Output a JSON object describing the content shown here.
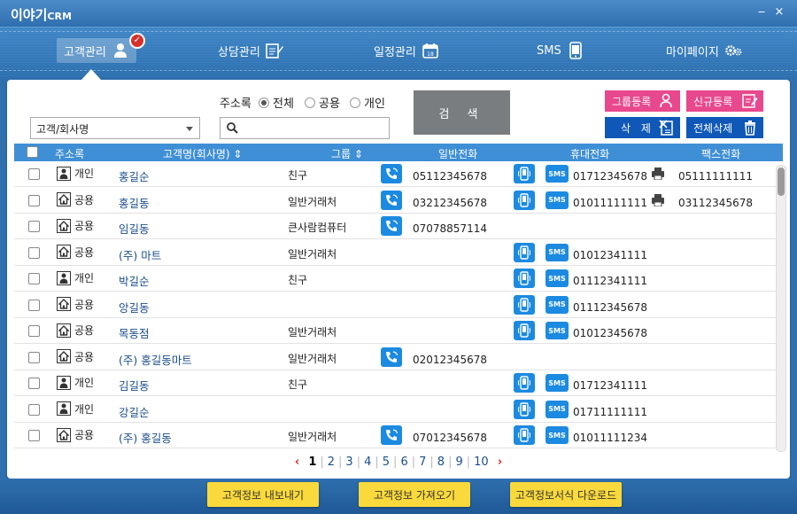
{
  "app": {
    "logo_main": "이야기",
    "logo_sub": "CRM",
    "min_label": "‒",
    "close_label": "×"
  },
  "nav": [
    {
      "label": "고객관리",
      "icon": "person-icon",
      "active": true
    },
    {
      "label": "상담관리",
      "icon": "notepad-edit-icon"
    },
    {
      "label": "일정관리",
      "icon": "calendar-icon"
    },
    {
      "label": "SMS",
      "icon": "phone-icon"
    },
    {
      "label": "마이페이지",
      "icon": "gears-icon"
    }
  ],
  "filter": {
    "select_value": "고객/회사명",
    "address_label": "주소록",
    "radios": [
      {
        "label": "전체",
        "checked": true
      },
      {
        "label": "공용",
        "checked": false
      },
      {
        "label": "개인",
        "checked": false
      }
    ],
    "search_placeholder": "",
    "search_button": "검 색"
  },
  "actions": {
    "group_register": "그룹등록",
    "new_register": "신규등록",
    "delete": "삭 제",
    "delete_all": "전체삭제"
  },
  "table": {
    "headers": {
      "address": "주소록",
      "name": "고객명(회사명)",
      "group": "그룹",
      "phone": "일반전화",
      "mobile": "휴대전화",
      "fax": "팩스전화"
    },
    "sms_label": "SMS",
    "rows": [
      {
        "type": "개인",
        "name": "홍길순",
        "group": "친구",
        "phone": "05112345678",
        "mobile": "01712345678",
        "fax": "05111111111"
      },
      {
        "type": "공용",
        "name": "홍길동",
        "group": "일반거래처",
        "phone": "03212345678",
        "mobile": "01011111111",
        "fax": "03112345678"
      },
      {
        "type": "공용",
        "name": "임길동",
        "group": "큰사람컴퓨터",
        "phone": "07078857114",
        "mobile": "",
        "fax": ""
      },
      {
        "type": "공용",
        "name": "(주) 마트",
        "group": "일반거래처",
        "phone": "",
        "mobile": "01012341111",
        "fax": ""
      },
      {
        "type": "개인",
        "name": "박길순",
        "group": "친구",
        "phone": "",
        "mobile": "01112341111",
        "fax": ""
      },
      {
        "type": "공용",
        "name": "앙길동",
        "group": "",
        "phone": "",
        "mobile": "01112345678",
        "fax": ""
      },
      {
        "type": "공용",
        "name": "목동점",
        "group": "일반거래처",
        "phone": "",
        "mobile": "01012345678",
        "fax": ""
      },
      {
        "type": "공용",
        "name": "(주) 홍길동마트",
        "group": "일반거래처",
        "phone": "02012345678",
        "mobile": "",
        "fax": ""
      },
      {
        "type": "개인",
        "name": "김길동",
        "group": "친구",
        "phone": "",
        "mobile": "01712341111",
        "fax": ""
      },
      {
        "type": "개인",
        "name": "강길순",
        "group": "",
        "phone": "",
        "mobile": "01711111111",
        "fax": ""
      },
      {
        "type": "공용",
        "name": "(주) 홍길동",
        "group": "일반거래처",
        "phone": "07012345678",
        "mobile": "01011111234",
        "fax": ""
      }
    ]
  },
  "pager": {
    "prev": "‹",
    "next": "›",
    "pages": [
      "1",
      "2",
      "3",
      "4",
      "5",
      "6",
      "7",
      "8",
      "9",
      "10"
    ],
    "current": "1"
  },
  "footer": {
    "export": "고객정보 내보내기",
    "import": "고객정보 가져오기",
    "template_download": "고객정보서식 다운로드"
  },
  "colors": {
    "nav_blue": "#2f6fae",
    "header_blue": "#3f8fd6",
    "icon_blue": "#1c8ae0",
    "pink": "#e8488d",
    "dark_blue": "#0f58b8",
    "yellow": "#f9d93b"
  }
}
